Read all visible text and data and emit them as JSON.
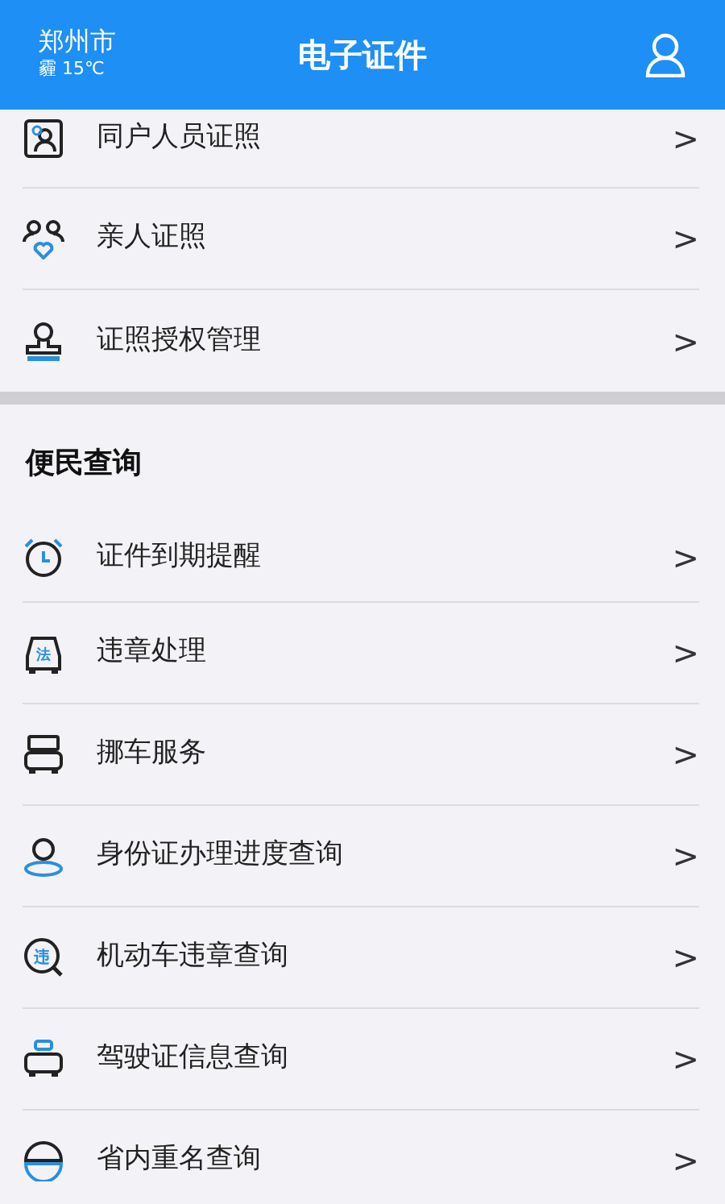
{
  "header": {
    "city": "郑州市",
    "weather": "霾 15℃",
    "title": "电子证件"
  },
  "certificates": [
    {
      "kind": "household",
      "label": "同户人员证照",
      "chevron": ">"
    },
    {
      "kind": "family",
      "label": "亲人证照",
      "chevron": ">"
    },
    {
      "kind": "stamp",
      "label": "证照授权管理",
      "chevron": ">"
    }
  ],
  "section": {
    "title": "便民查询",
    "items": [
      {
        "kind": "alarm",
        "label": "证件到期提醒",
        "chevron": ">"
      },
      {
        "kind": "law-car",
        "icon_text": "法",
        "label": "违章处理",
        "chevron": ">"
      },
      {
        "kind": "car-front",
        "label": "挪车服务",
        "chevron": ">"
      },
      {
        "kind": "person",
        "label": "身份证办理进度查询",
        "chevron": ">"
      },
      {
        "kind": "search-badge",
        "icon_text": "违",
        "label": "机动车违章查询",
        "chevron": ">"
      },
      {
        "kind": "seat",
        "label": "驾驶证信息查询",
        "chevron": ">"
      },
      {
        "kind": "half-circle",
        "label": "省内重名查询",
        "chevron": ">"
      }
    ]
  }
}
